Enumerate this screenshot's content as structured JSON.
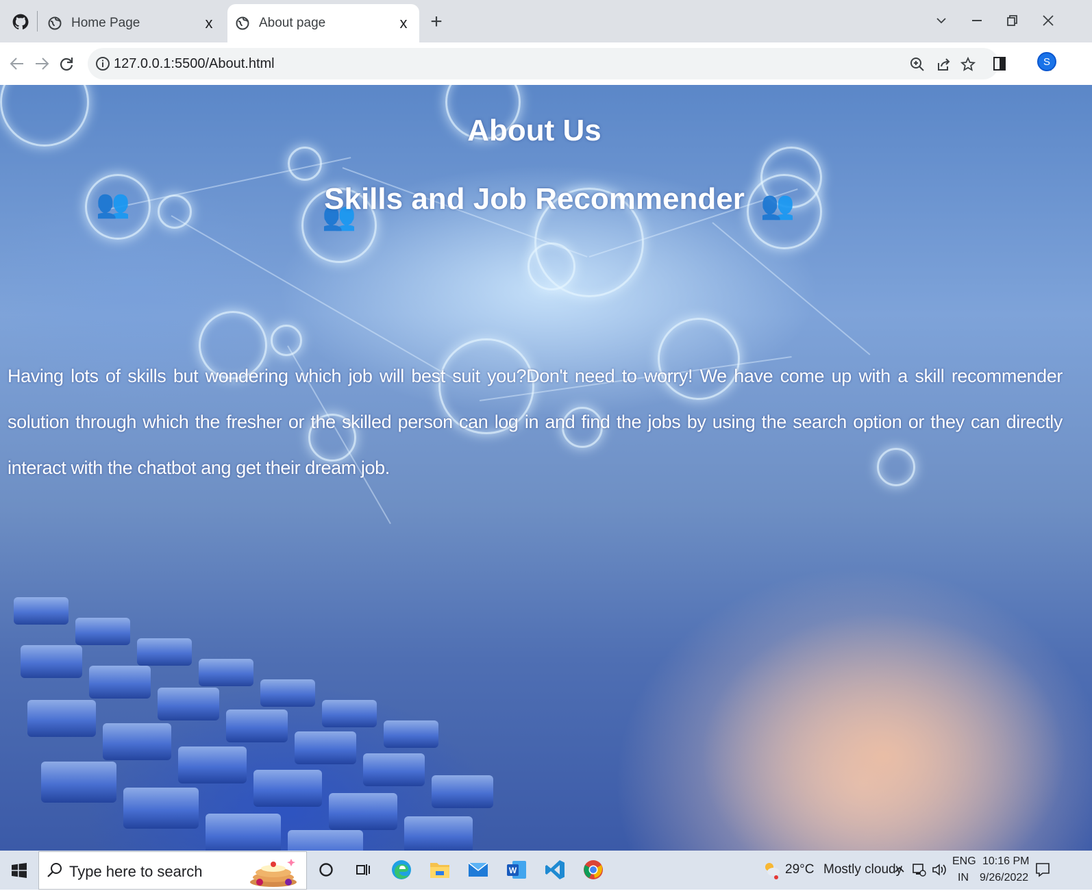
{
  "browser": {
    "tabs": [
      {
        "title": "Home Page",
        "active": false
      },
      {
        "title": "About page",
        "active": true
      }
    ],
    "new_tab_label": "+",
    "tab_close_label": "x",
    "url": "127.0.0.1:5500/About.html",
    "profile_initial": "S"
  },
  "page": {
    "heading": "About Us",
    "subheading": "Skills and Job Recommender",
    "paragraph": "Having lots of skills but wondering which job will best suit you?Don't need to worry! We have come up with a skill recommender solution through which the fresher or the skilled person can log in and find the jobs by using the search option or they can directly interact with the chatbot ang get their dream job."
  },
  "taskbar": {
    "search_placeholder": "Type here to search",
    "weather_temp": "29°C",
    "weather_desc": "Mostly cloudy",
    "lang_top": "ENG",
    "lang_bottom": "IN",
    "time": "10:16 PM",
    "date": "9/26/2022"
  },
  "colors": {
    "tabstrip_bg": "#dee1e6",
    "omnibox_bg": "#f1f3f4",
    "taskbar_bg": "#dce3ed",
    "avatar": "#1a73e8",
    "heading_text": "#ffffff"
  }
}
